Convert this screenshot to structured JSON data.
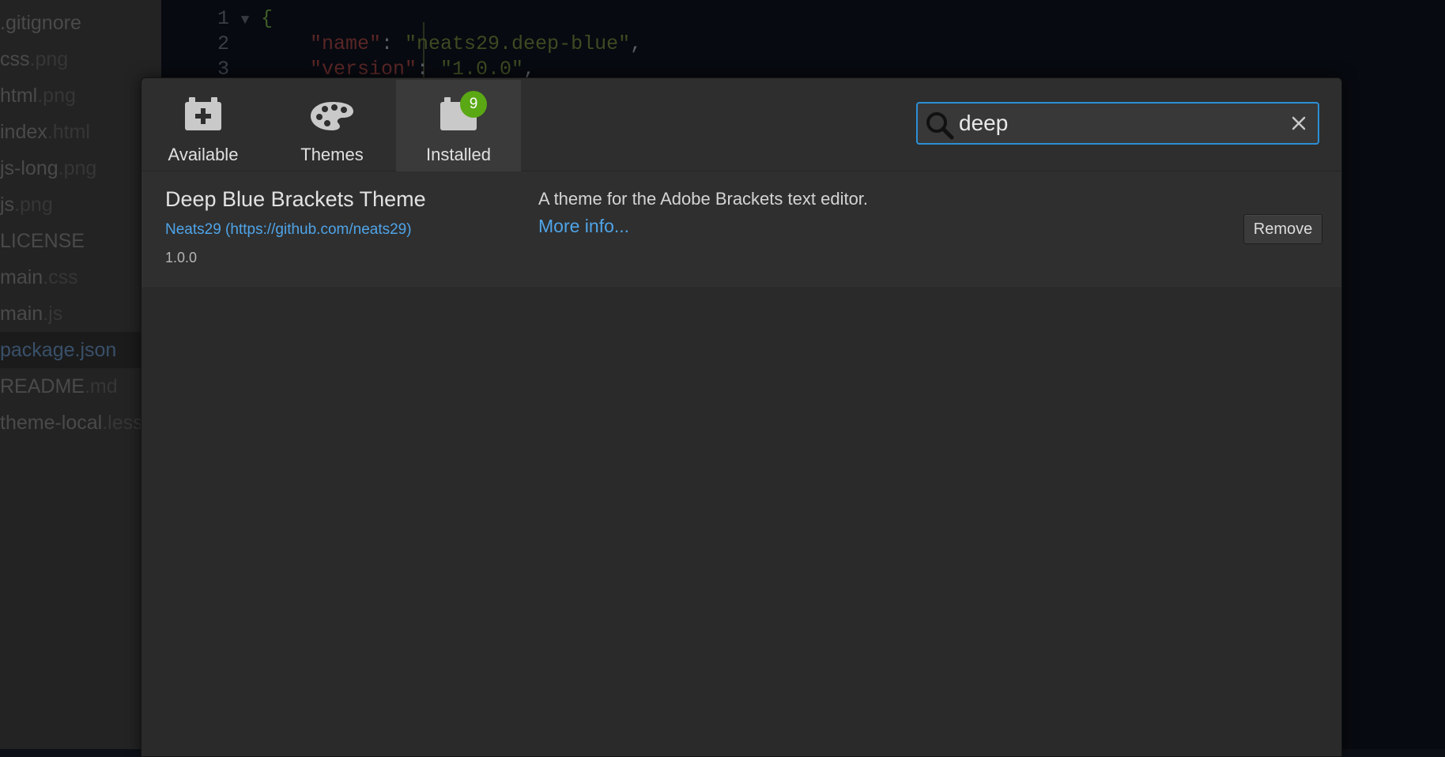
{
  "sidebar": {
    "files": [
      {
        "name": ".gitignore",
        "ext": ""
      },
      {
        "name": "css",
        "ext": ".png"
      },
      {
        "name": "html",
        "ext": ".png"
      },
      {
        "name": "index",
        "ext": ".html"
      },
      {
        "name": "js-long",
        "ext": ".png"
      },
      {
        "name": "js",
        "ext": ".png"
      },
      {
        "name": "LICENSE",
        "ext": ""
      },
      {
        "name": "main",
        "ext": ".css"
      },
      {
        "name": "main",
        "ext": ".js"
      },
      {
        "name": "package.json",
        "ext": ""
      },
      {
        "name": "README",
        "ext": ".md"
      },
      {
        "name": "theme-local",
        "ext": ".less"
      }
    ],
    "selected_index": 9
  },
  "editor": {
    "lines": [
      {
        "num": "1",
        "fold": "▼",
        "text": "{"
      },
      {
        "num": "2",
        "key": "\"name\"",
        "colon": ": ",
        "value": "\"neats29.deep-blue\"",
        "tail": ","
      },
      {
        "num": "3",
        "key": "\"version\"",
        "colon": ": ",
        "value": "\"1.0.0\"",
        "tail": ","
      }
    ]
  },
  "dialog": {
    "tabs": [
      {
        "label": "Available",
        "icon": "plus-block-icon"
      },
      {
        "label": "Themes",
        "icon": "palette-icon"
      },
      {
        "label": "Installed",
        "icon": "block-icon",
        "badge": "9",
        "active": true
      }
    ],
    "search": {
      "value": "deep",
      "icon": "search-icon",
      "clear_icon": "close-icon"
    },
    "extension": {
      "title": "Deep Blue Brackets Theme",
      "author": "Neats29 (https://github.com/neats29)",
      "version": "1.0.0",
      "description": "A theme for the Adobe Brackets text editor.",
      "more_info": "More info...",
      "remove_label": "Remove"
    }
  },
  "colors": {
    "accent_blue": "#2c8fd6",
    "link_blue": "#4fa4e8",
    "badge_green": "#5aa814"
  }
}
